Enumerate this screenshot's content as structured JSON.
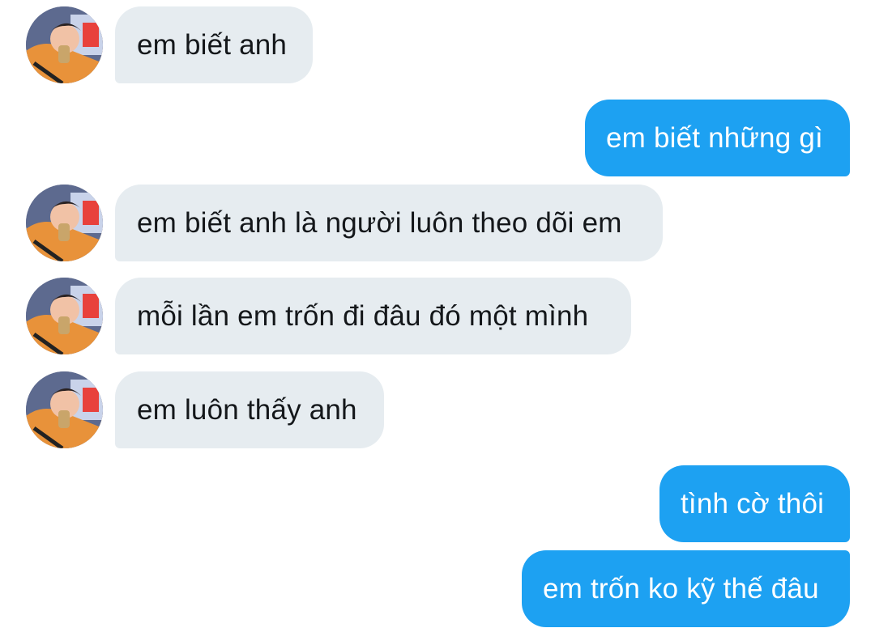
{
  "messages": [
    {
      "side": "in",
      "text": "em biết anh"
    },
    {
      "side": "out",
      "text": "em biết những gì"
    },
    {
      "side": "in",
      "text": "em biết anh là người luôn theo dõi em"
    },
    {
      "side": "in",
      "text": "mỗi lần em trốn đi đâu đó một mình"
    },
    {
      "side": "in",
      "text": "em luôn thấy anh"
    },
    {
      "side": "out",
      "text": "tình cờ thôi"
    },
    {
      "side": "out",
      "text": "em trốn ko kỹ thế đâu"
    }
  ],
  "colors": {
    "incoming_bubble": "#e6ecf0",
    "outgoing_bubble": "#1da1f2",
    "incoming_text": "#14171a",
    "outgoing_text": "#ffffff"
  },
  "icons": {
    "avatar": "user-avatar-photo"
  }
}
